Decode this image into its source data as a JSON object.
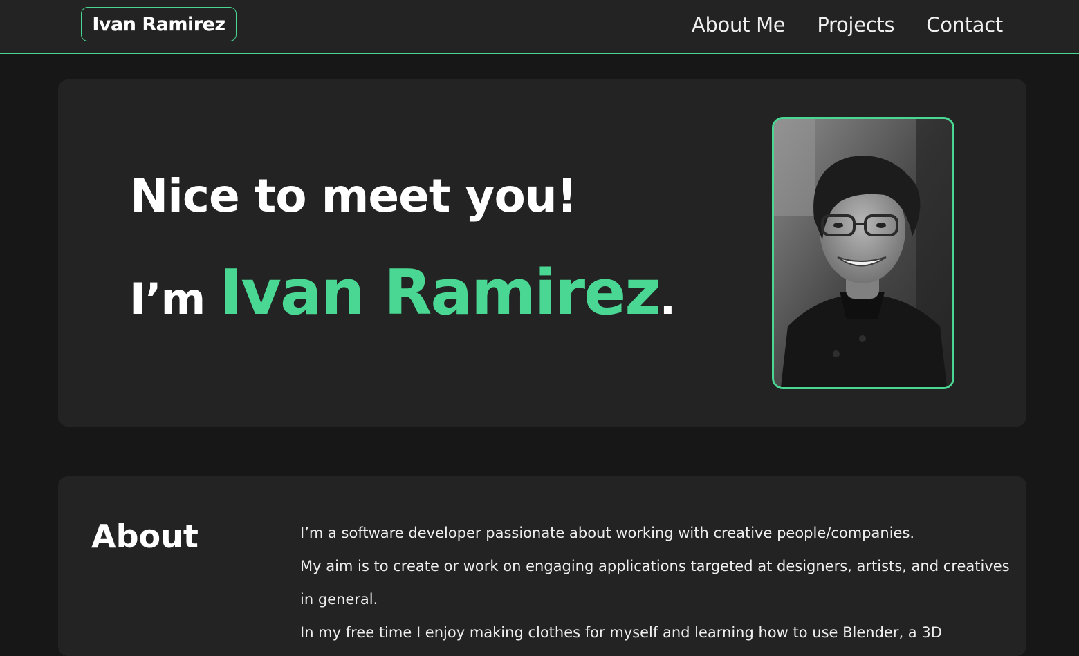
{
  "header": {
    "logo": "Ivan Ramirez",
    "nav": [
      {
        "label": "About Me"
      },
      {
        "label": "Projects"
      },
      {
        "label": "Contact"
      }
    ]
  },
  "hero": {
    "greeting": "Nice to meet you!",
    "intro_prefix": "I’m ",
    "name": "Ivan Ramirez",
    "intro_suffix": ".",
    "photo_alt": "Portrait photo"
  },
  "about": {
    "title": "About",
    "paragraphs": [
      "I’m a software developer passionate about working with creative people/companies.",
      "My aim is to create or work on engaging applications targeted at designers, artists, and creatives in general.",
      "In my free time I enjoy making clothes for myself and learning how to use Blender, a 3D"
    ]
  },
  "colors": {
    "accent": "#4ad693",
    "background": "#171717",
    "card": "#232323",
    "text": "#ffffff"
  }
}
